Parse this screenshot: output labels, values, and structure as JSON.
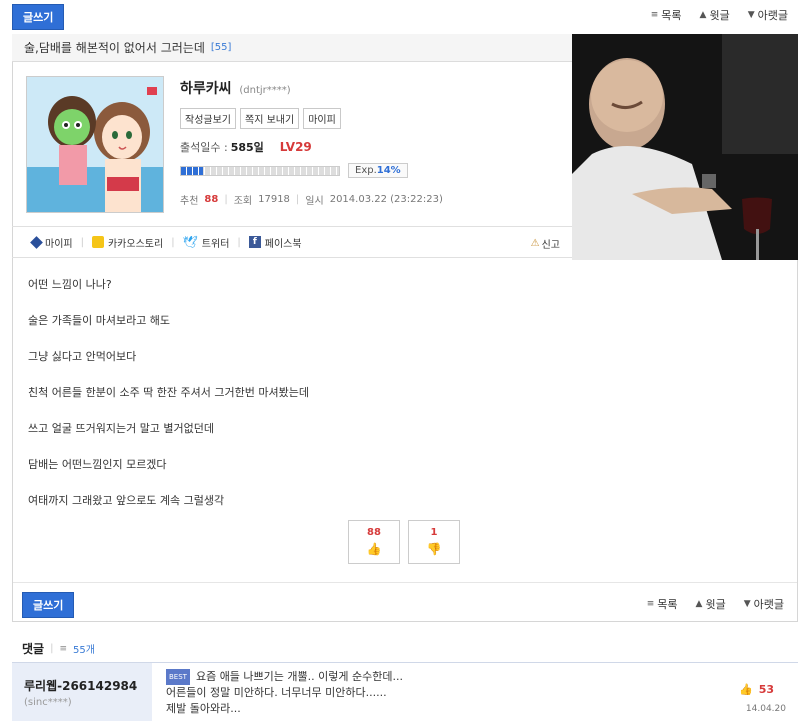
{
  "toolbar": {
    "write_label": "글쓰기",
    "list_label": "목록",
    "prev_label": "윗글",
    "next_label": "아랫글"
  },
  "post": {
    "title": "술,담배를 해본적이 없어서 그러는데",
    "comment_count_badge": "[55]",
    "author": {
      "name": "하루카씨",
      "id": "(dntjr****)",
      "buttons": [
        "작성글보기",
        "쪽지 보내기",
        "마이피"
      ],
      "attendance_label": "출석일수 :",
      "attendance_value": "585일",
      "level": "LV29",
      "exp_label": "Exp.",
      "exp_value": "14%",
      "exp_fraction": 0.14
    },
    "stats": {
      "recommend_label": "추천",
      "recommend_value": "88",
      "views_label": "조회",
      "views_value": "17918",
      "date_label": "일시",
      "date_value": "2014.03.22 (23:22:23)"
    },
    "share": [
      "마이피",
      "카카오스토리",
      "트위터",
      "페이스북"
    ],
    "report_label": "신고",
    "body": [
      "어떤 느낌이 나나?",
      "술은 가족들이 마셔보라고 해도",
      "그냥 싫다고 안먹어보다",
      "친척 어른들 한분이 소주 딱 한잔 주셔서 그거한번 마셔봤는데",
      "쓰고 얼굴 뜨거워지는거 말고 별거없던데",
      "담배는 어떤느낌인지 모르겠다",
      "여태까지 그래왔고 앞으로도 계속 그럴생각"
    ],
    "upvotes": "88",
    "downvotes": "1"
  },
  "comments": {
    "heading": "댓글",
    "count": "55개",
    "items": [
      {
        "name": "루리웹-266142984",
        "id": "(sinc****)",
        "badge": "BEST",
        "lines": [
          "요즘 애들 나쁘기는 개뿔.. 이렇게 순수한데...",
          "어른들이 정말 미안하다. 너무너무 미안하다......",
          "제발 돌아와라..."
        ],
        "likes": "53",
        "date": "14.04.20"
      }
    ]
  },
  "colors": {
    "accent": "#2f6fd6",
    "red": "#d63a3a",
    "link": "#3a7bd5"
  }
}
